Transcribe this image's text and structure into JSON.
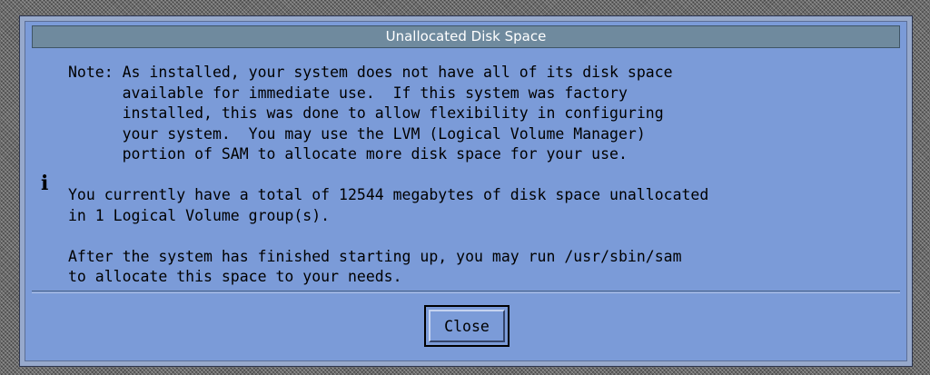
{
  "dialog": {
    "title": "Unallocated Disk Space",
    "icon": "info-icon",
    "icon_glyph": "i",
    "message": "Note: As installed, your system does not have all of its disk space\n      available for immediate use.  If this system was factory\n      installed, this was done to allow flexibility in configuring\n      your system.  You may use the LVM (Logical Volume Manager)\n      portion of SAM to allocate more disk space for your use.\n\nYou currently have a total of 12544 megabytes of disk space unallocated\nin 1 Logical Volume group(s).\n\nAfter the system has finished starting up, you may run /usr/sbin/sam\nto allocate this space to your needs.",
    "buttons": {
      "close": "Close"
    }
  },
  "colors": {
    "dialog_background": "#7b9bd8",
    "titlebar_background": "#6f8a9e",
    "title_text": "#ffffff",
    "desktop_pattern": "#6a6a6a"
  }
}
